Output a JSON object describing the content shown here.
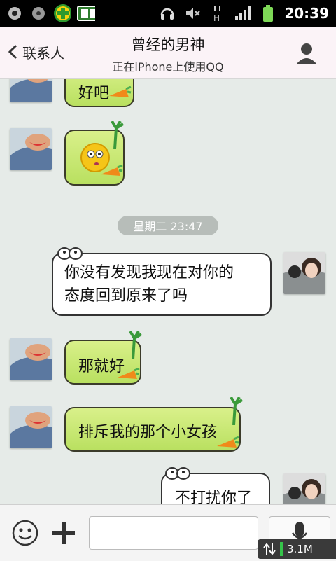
{
  "status_bar": {
    "time": "20:39",
    "network": "H"
  },
  "header": {
    "back_label": "联系人",
    "title": "曾经的男神",
    "subtitle": "正在iPhone上使用QQ"
  },
  "messages": [
    {
      "from": "contact",
      "text": "好吧"
    },
    {
      "from": "contact",
      "type": "emoji",
      "emoji": "confused-face"
    },
    {
      "type": "time",
      "text": "星期二 23:47"
    },
    {
      "from": "me",
      "text": "你没有发现我现在对你的态度回到原来了吗",
      "line1": "你没有发现我现在对你的",
      "line2": "态度回到原来了吗"
    },
    {
      "from": "contact",
      "text": "那就好"
    },
    {
      "from": "contact",
      "text": "排斥我的那个小女孩"
    },
    {
      "from": "me",
      "text": "不打扰你了"
    }
  ],
  "input_bar": {
    "placeholder": "",
    "value": ""
  },
  "traffic": {
    "label": "3.1M"
  },
  "colors": {
    "incoming_bubble": "#c7e874",
    "outgoing_bubble": "#ffffff",
    "header_bg": "#fbf3f7"
  }
}
